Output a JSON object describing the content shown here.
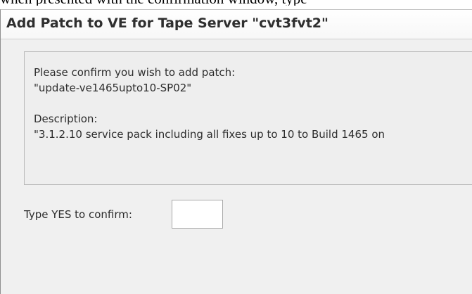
{
  "window": {
    "title": "Add Patch to VE for Tape Server \"cvt3fvt2\""
  },
  "message": {
    "confirm_line": "Please confirm you wish to add patch:",
    "patch_name": "\"update-ve1465upto10-SP02\"",
    "description_label": "Description:",
    "description_text": "\"3.1.2.10 service pack including all fixes up to 10 to Build 1465 on"
  },
  "confirm": {
    "label": "Type YES to confirm:",
    "value": "",
    "placeholder": ""
  },
  "top_fragment": {
    "text": "when presented with the confirmation window, type"
  }
}
